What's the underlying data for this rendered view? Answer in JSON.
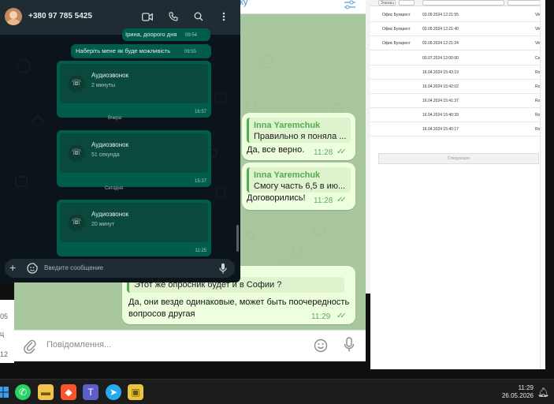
{
  "spreadsheet": {
    "header_controls": [
      "Заказы",
      "",
      ""
    ],
    "rows": [
      {
        "office": "Офис Бухарест",
        "date": "03.09.2024 12:21:55",
        "user": "Vik"
      },
      {
        "office": "Офис Бухарест",
        "date": "03.09.2024 12:21:40",
        "user": "Vik"
      },
      {
        "office": "Офис Бухарест",
        "date": "03.09.2024 12:21:24",
        "user": "Vik"
      },
      {
        "office": "",
        "date": "03.07.2024 12:00:00",
        "user": "Ce"
      },
      {
        "office": "",
        "date": "16.04.2024 15:43:19",
        "user": "Ro"
      },
      {
        "office": "",
        "date": "16.04.2024 15:42:02",
        "user": "Ro"
      },
      {
        "office": "",
        "date": "16.04.2024 15:41:37",
        "user": "Ro"
      },
      {
        "office": "",
        "date": "16.04.2024 15:40:39",
        "user": "Ro"
      },
      {
        "office": "",
        "date": "16.04.2024 15:40:17",
        "user": "Ro"
      }
    ],
    "next_button": "Следующая"
  },
  "telegram": {
    "header_link": "ку",
    "messages": [
      {
        "reply_name": "Inna Yaremchuk",
        "reply_text": "Правильно я поняла ...",
        "text": "Да, все верно.",
        "time": "11:28"
      },
      {
        "reply_name": "Inna Yaremchuk",
        "reply_text": "Смогу часть 6,5  в ию...",
        "text": "Договорились!",
        "time": "11:28"
      },
      {
        "reply_text": "Этот же опросник будет и в Софии ?",
        "text_line1": "Да, они везде одинаковые, может быть поочередность",
        "text_line2": "вопросов другая",
        "time": "11:29"
      }
    ],
    "compose_placeholder": "Повідомлення..."
  },
  "left_strip": [
    "05",
    "ц",
    "12"
  ],
  "whatsapp": {
    "phone": "+380 97 785 5425",
    "messages": [
      {
        "text": "Ірина, доорого дня",
        "time": "09:54"
      },
      {
        "text": "Наберіть мене як буде можливість",
        "time": "09:55"
      }
    ],
    "calls": [
      {
        "title": "Аудиозвонок",
        "duration": "2 минуты",
        "time": "16:57"
      },
      {
        "title": "Аудиозвонок",
        "duration": "51 секунда",
        "time": "15:37"
      },
      {
        "title": "Аудиозвонок",
        "duration": "20 минут",
        "time": "11:25"
      }
    ],
    "day_separators": [
      "Вчера",
      "Сегодня"
    ],
    "input_placeholder": "Введите сообщение"
  },
  "taskbar": {
    "time": "11:29",
    "date": "26.05.2026",
    "apps": [
      "windows-start",
      "whatsapp",
      "file-explorer",
      "brave",
      "teams",
      "telegram",
      "notes"
    ]
  }
}
